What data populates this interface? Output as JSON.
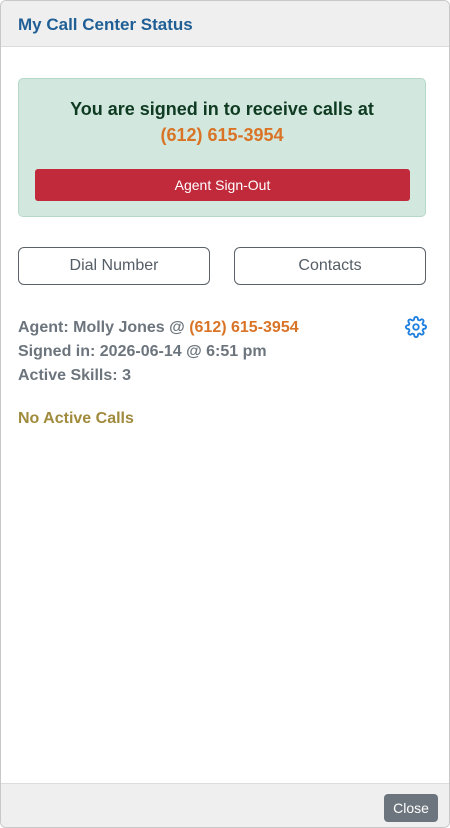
{
  "header": {
    "title": "My Call Center Status"
  },
  "status": {
    "line1": "You are signed in to receive calls at",
    "phone": "(612) 615-3954",
    "signout_label": "Agent Sign-Out"
  },
  "actions": {
    "dial_label": "Dial Number",
    "contacts_label": "Contacts"
  },
  "agent": {
    "label": "Agent:",
    "name": "Molly Jones",
    "at": "@",
    "phone": "(612) 615-3954",
    "signed_in_label": "Signed in:",
    "signed_in_value": "2026-06-14 @ 6:51 pm",
    "skills_label": "Active Skills:",
    "skills_value": "3",
    "settings_icon": "gear-icon"
  },
  "calls": {
    "empty_text": "No Active Calls"
  },
  "footer": {
    "close_label": "Close"
  },
  "colors": {
    "accent_blue": "#1f5f95",
    "phone_orange": "#d97427",
    "signout_red": "#c02a3b",
    "status_green_bg": "#d2e8df",
    "muted_gray": "#6c757d",
    "no_calls_gold": "#a08a3c"
  }
}
